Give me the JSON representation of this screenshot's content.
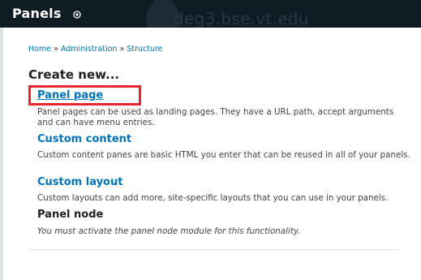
{
  "header": {
    "title": "Panels",
    "site_name": "deg3.bse.vt.edu",
    "bg_color": "#0f1c24"
  },
  "breadcrumb": {
    "items": [
      "Home",
      "Administration",
      "Structure"
    ],
    "separator": "»"
  },
  "page_title": "Create new...",
  "items": [
    {
      "title": "Panel page",
      "description": "Panel pages can be used as landing pages. They have a URL path, accept arguments and can have menu entries."
    },
    {
      "title": "Custom content",
      "description": "Custom content panes are basic HTML you enter that can be reused in all of your panels."
    },
    {
      "title": "Custom layout",
      "description": "Custom layouts can add more, site-specific layouts that you can use in your panels."
    },
    {
      "title": "Panel node",
      "description": "You must activate the panel node module for this functionality."
    }
  ],
  "colors": {
    "link": "#0074bd",
    "highlight": "#e8242e"
  },
  "icons": {
    "shortcut": "add-shortcut-icon",
    "logo": "drupal-drop-icon"
  }
}
